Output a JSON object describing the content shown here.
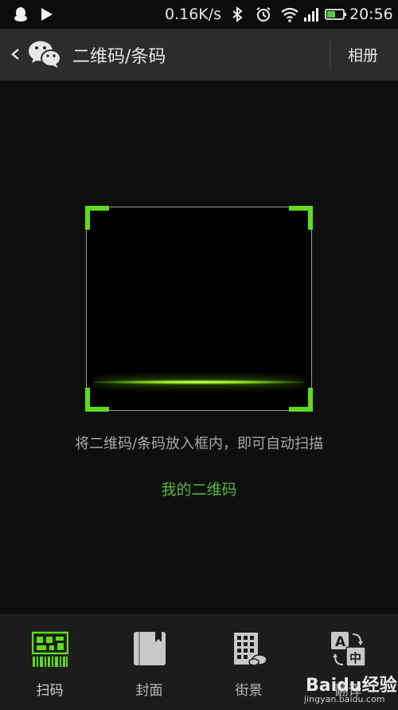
{
  "status_bar": {
    "speed": "0.16K/s",
    "time": "20:56",
    "icons": [
      "qq-icon",
      "play-icon",
      "bluetooth-icon",
      "alarm-icon",
      "wifi-icon",
      "signal-icon",
      "battery-icon"
    ]
  },
  "header": {
    "title": "二维码/条码",
    "album_label": "相册",
    "icons": [
      "back-chevron-icon",
      "wechat-logo-icon"
    ]
  },
  "scanner": {
    "hint": "将二维码/条码放入框内，即可自动扫描",
    "my_qr_label": "我的二维码",
    "accent_color": "#5edc1f",
    "link_color": "#57b93a"
  },
  "tabs": [
    {
      "label": "扫码",
      "icon": "scan-code-icon",
      "active": true
    },
    {
      "label": "封面",
      "icon": "book-cover-icon",
      "active": false
    },
    {
      "label": "街景",
      "icon": "street-view-icon",
      "active": false
    },
    {
      "label": "翻译",
      "icon": "translate-icon",
      "active": false
    }
  ],
  "watermark": {
    "main": "Baidu经验",
    "sub": "jingyan.baidu.com"
  }
}
